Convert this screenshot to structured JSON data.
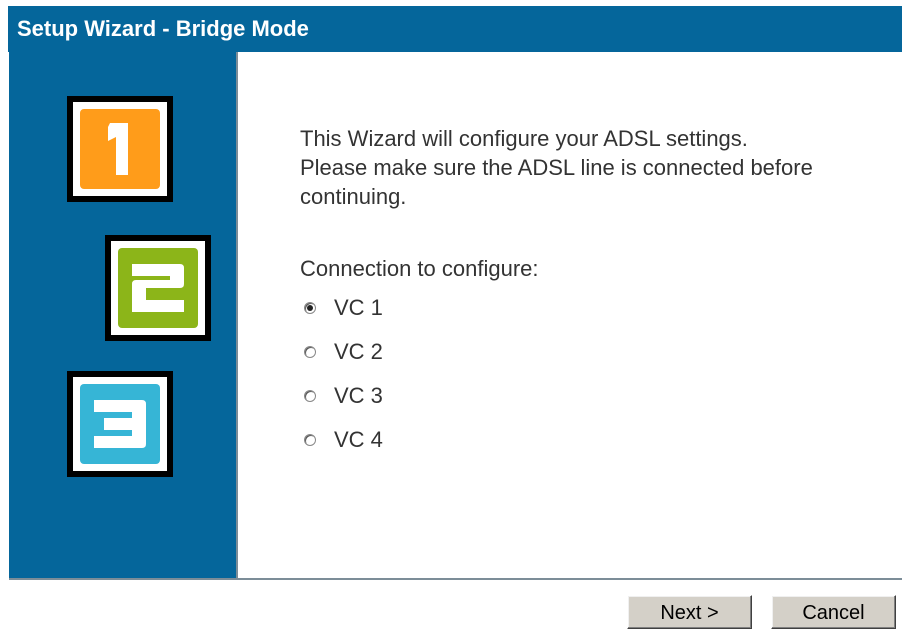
{
  "window": {
    "title": "Setup Wizard - Bridge Mode"
  },
  "steps": [
    {
      "number": "1",
      "color": "#ff9c1a"
    },
    {
      "number": "2",
      "color": "#8cb519"
    },
    {
      "number": "3",
      "color": "#36b5d6"
    }
  ],
  "intro": {
    "line1": "This Wizard will configure your ADSL settings.",
    "line2": "Please make sure the ADSL line is connected before",
    "line3": "continuing."
  },
  "connection": {
    "label": "Connection to configure:",
    "options": [
      {
        "label": "VC 1",
        "selected": true
      },
      {
        "label": "VC 2",
        "selected": false
      },
      {
        "label": "VC 3",
        "selected": false
      },
      {
        "label": "VC 4",
        "selected": false
      }
    ]
  },
  "buttons": {
    "next": "Next >",
    "cancel": "Cancel"
  },
  "colors": {
    "title_bar": "#05669b",
    "sidebar": "#05669b"
  }
}
